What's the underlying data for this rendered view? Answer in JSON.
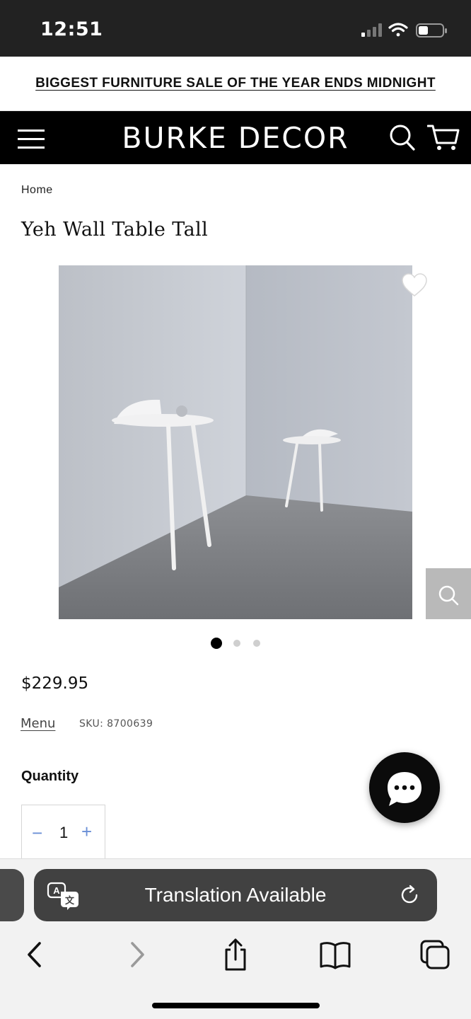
{
  "status_bar": {
    "time": "12:51"
  },
  "promo": {
    "text": "BIGGEST FURNITURE SALE OF THE YEAR ENDS MIDNIGHT"
  },
  "header": {
    "brand": "BURKE DECOR"
  },
  "breadcrumb": {
    "home": "Home"
  },
  "product": {
    "title": "Yeh Wall Table Tall",
    "price": "$229.95",
    "menu_link": "Menu",
    "sku": "SKU: 8700639",
    "quantity_label": "Quantity",
    "quantity_value": "1",
    "quantity_minus": "−",
    "quantity_plus": "+",
    "gallery_active_index": 1,
    "gallery_count": 3
  },
  "safari": {
    "translation_text": "Translation Available"
  },
  "colors": {
    "header_bg": "#000000",
    "status_bg": "#222222",
    "qty_accent": "#6a8fd6",
    "chat_bg": "#0b0b0b"
  },
  "icons": {
    "header": [
      "menu-icon",
      "search-icon",
      "cart-icon"
    ],
    "image": [
      "heart-icon",
      "zoom-icon"
    ],
    "chat": "chat-bubble-icon",
    "safari": [
      "translate-icon",
      "reload-icon",
      "back-icon",
      "forward-icon",
      "share-icon",
      "bookmarks-icon",
      "tabs-icon"
    ]
  }
}
